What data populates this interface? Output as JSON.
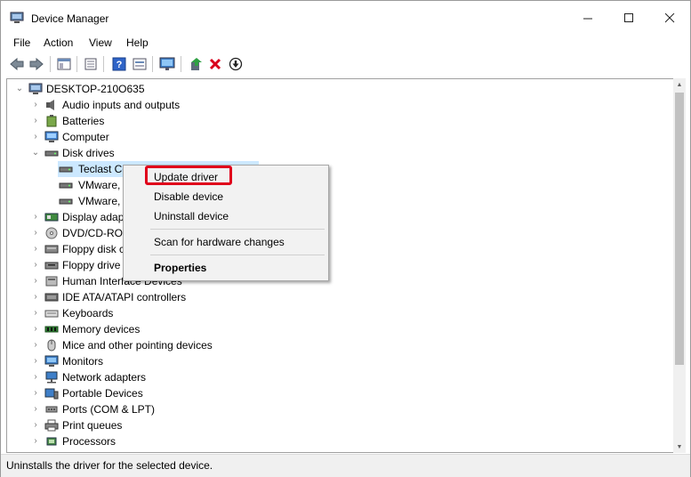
{
  "window": {
    "title": "Device Manager"
  },
  "titlebar_buttons": {
    "minimize": "—",
    "maximize": "☐",
    "close": "✕"
  },
  "menu": [
    "File",
    "Action",
    "View",
    "Help"
  ],
  "toolbar": {
    "icons": [
      "back-icon",
      "forward-icon",
      "properties-pane-icon",
      "device-list-icon",
      "help-icon",
      "view-icon",
      "monitor-icon",
      "update-driver-icon",
      "uninstall-icon",
      "download-icon"
    ]
  },
  "tree": {
    "root": "DESKTOP-210O635",
    "items": [
      {
        "label": "Audio inputs and outputs",
        "icon": "speaker-icon"
      },
      {
        "label": "Batteries",
        "icon": "battery-icon"
      },
      {
        "label": "Computer",
        "icon": "computer-icon"
      },
      {
        "label": "Disk drives",
        "icon": "disk-drive-icon",
        "expanded": true
      },
      {
        "label": "Teclast Co",
        "icon": "disk-icon",
        "child": true,
        "selected": true
      },
      {
        "label": "VMware,",
        "icon": "disk-icon",
        "child": true
      },
      {
        "label": "VMware,",
        "icon": "disk-icon",
        "child": true
      },
      {
        "label": "Display adapt",
        "icon": "display-adapter-icon"
      },
      {
        "label": "DVD/CD-ROM",
        "icon": "dvd-icon"
      },
      {
        "label": "Floppy disk c",
        "icon": "floppy-controller-icon"
      },
      {
        "label": "Floppy drive",
        "icon": "floppy-drive-icon"
      },
      {
        "label": "Human Interface Devices",
        "icon": "hid-icon"
      },
      {
        "label": "IDE ATA/ATAPI controllers",
        "icon": "ide-icon"
      },
      {
        "label": "Keyboards",
        "icon": "keyboard-icon"
      },
      {
        "label": "Memory devices",
        "icon": "memory-icon"
      },
      {
        "label": "Mice and other pointing devices",
        "icon": "mouse-icon"
      },
      {
        "label": "Monitors",
        "icon": "monitor-icon"
      },
      {
        "label": "Network adapters",
        "icon": "network-icon"
      },
      {
        "label": "Portable Devices",
        "icon": "portable-device-icon"
      },
      {
        "label": "Ports (COM & LPT)",
        "icon": "port-icon"
      },
      {
        "label": "Print queues",
        "icon": "printer-icon"
      },
      {
        "label": "Processors",
        "icon": "processor-icon"
      }
    ]
  },
  "context_menu": {
    "update_driver": "Update driver",
    "disable_device": "Disable device",
    "uninstall_device": "Uninstall device",
    "scan": "Scan for hardware changes",
    "properties": "Properties"
  },
  "status": "Uninstalls the driver for the selected device.",
  "colors": {
    "highlight_box": "#e0001b",
    "selection": "#cce8ff",
    "menu_bg": "#f2f2f2"
  }
}
